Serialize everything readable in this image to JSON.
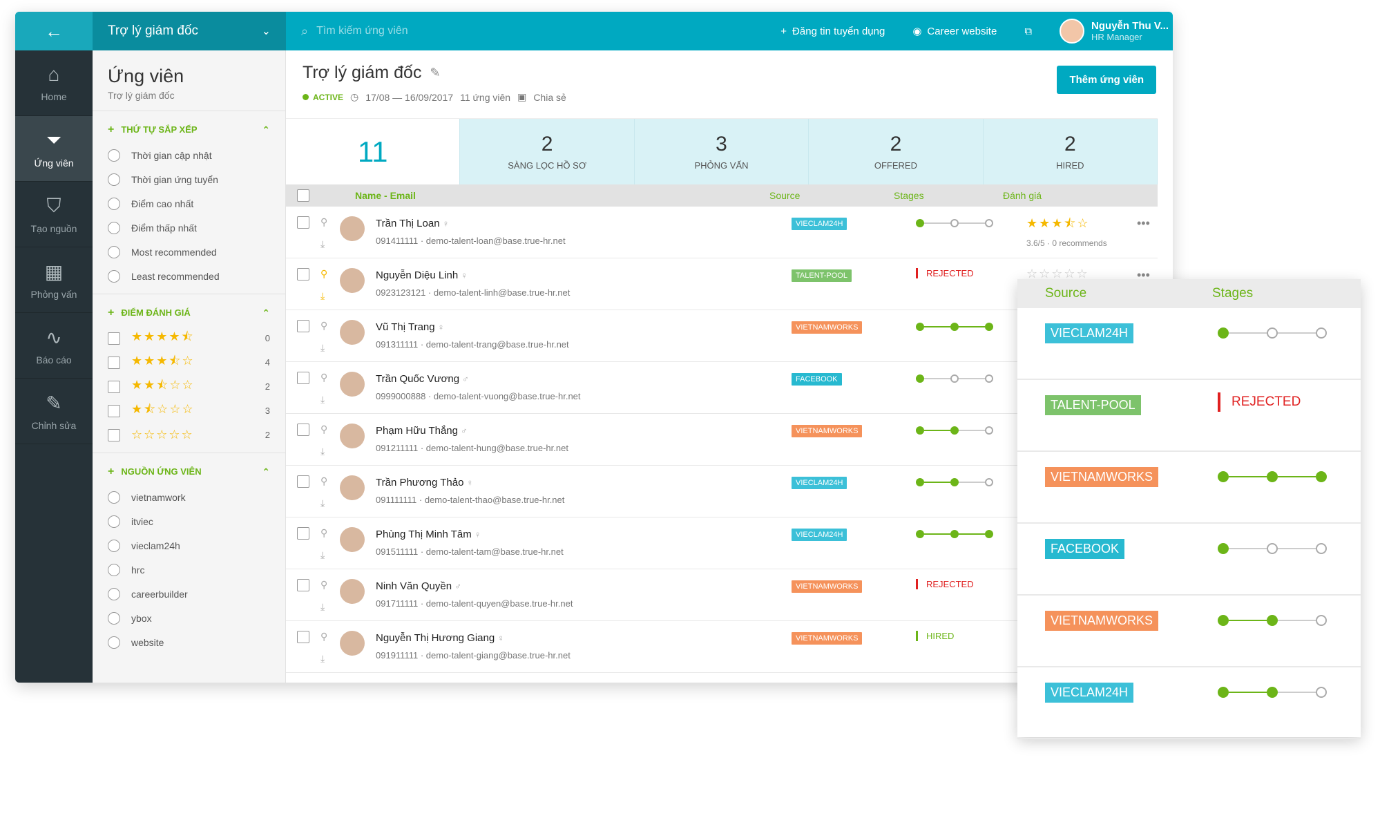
{
  "topbar": {
    "job_title": "Trợ lý giám đốc",
    "search_placeholder": "Tìm kiếm ứng viên",
    "post_job": "Đăng tin tuyển dụng",
    "career_website": "Career website",
    "user_name": "Nguyễn Thu V...",
    "user_role": "HR Manager"
  },
  "nav": [
    {
      "label": "Home",
      "icon": "home-icon"
    },
    {
      "label": "Ứng viên",
      "icon": "filter-icon"
    },
    {
      "label": "Tạo nguồn",
      "icon": "source-icon"
    },
    {
      "label": "Phỏng vấn",
      "icon": "calendar-icon"
    },
    {
      "label": "Báo cáo",
      "icon": "chart-icon"
    },
    {
      "label": "Chỉnh sửa",
      "icon": "edit-icon"
    }
  ],
  "filters": {
    "title": "Ứng viên",
    "subtitle": "Trợ lý giám đốc",
    "sort": {
      "title": "THỨ TỰ SẮP XẾP",
      "options": [
        "Thời gian cập nhật",
        "Thời gian ứng tuyển",
        "Điểm cao nhất",
        "Điểm thấp nhất",
        "Most recommended",
        "Least recommended"
      ]
    },
    "rating": {
      "title": "ĐIỂM ĐÁNH GIÁ",
      "items": [
        {
          "stars": "★★★★⯪",
          "count": "0"
        },
        {
          "stars": "★★★⯪☆",
          "count": "4"
        },
        {
          "stars": "★★⯪☆☆",
          "count": "2"
        },
        {
          "stars": "★⯪☆☆☆",
          "count": "3"
        },
        {
          "stars": "☆☆☆☆☆",
          "count": "2"
        }
      ]
    },
    "source": {
      "title": "NGUỒN ỨNG VIÊN",
      "options": [
        "vietnamwork",
        "itviec",
        "vieclam24h",
        "hrc",
        "careerbuilder",
        "ybox",
        "website"
      ]
    }
  },
  "main": {
    "title": "Trợ lý giám đốc",
    "status": "ACTIVE",
    "dates": "17/08 — 16/09/2017",
    "count_text": "11 ứng viên",
    "share": "Chia sẻ",
    "add_button": "Thêm ứng viên",
    "pipeline": [
      {
        "num": "11",
        "label": ""
      },
      {
        "num": "2",
        "label": "SÀNG LỌC HỒ SƠ"
      },
      {
        "num": "3",
        "label": "PHỎNG VẤN"
      },
      {
        "num": "2",
        "label": "OFFERED"
      },
      {
        "num": "2",
        "label": "HIRED"
      }
    ],
    "columns": {
      "name": "Name - Email",
      "source": "Source",
      "stages": "Stages",
      "rating": "Đánh giá"
    },
    "candidates": [
      {
        "name": "Trần Thị Loan",
        "gender": "♀",
        "phone": "091411111",
        "email": "demo-talent-loan@base.true-hr.net",
        "source": "VIECLAM24H",
        "src_class": "vieclam",
        "stage": 1,
        "status": "",
        "stars": "★★★⯪☆",
        "rating_text": "3.6/5 · 0 recommends",
        "pinned": false
      },
      {
        "name": "Nguyễn Diệu Linh",
        "gender": "♀",
        "phone": "0923123121",
        "email": "demo-talent-linh@base.true-hr.net",
        "source": "TALENT-POOL",
        "src_class": "talent",
        "stage": 0,
        "status": "REJECTED",
        "stars": "☆☆☆☆☆",
        "rating_text": "",
        "pinned": true
      },
      {
        "name": "Vũ Thị Trang",
        "gender": "♀",
        "phone": "091311111",
        "email": "demo-talent-trang@base.true-hr.net",
        "source": "VIETNAMWORKS",
        "src_class": "vnw",
        "stage": 3,
        "status": "",
        "stars": "",
        "rating_text": "",
        "pinned": false
      },
      {
        "name": "Trần Quốc Vương",
        "gender": "♂",
        "phone": "0999000888",
        "email": "demo-talent-vuong@base.true-hr.net",
        "source": "FACEBOOK",
        "src_class": "fb",
        "stage": 1,
        "status": "",
        "stars": "",
        "rating_text": "",
        "pinned": false
      },
      {
        "name": "Phạm Hữu Thắng",
        "gender": "♂",
        "phone": "091211111",
        "email": "demo-talent-hung@base.true-hr.net",
        "source": "VIETNAMWORKS",
        "src_class": "vnw",
        "stage": 2,
        "status": "",
        "stars": "",
        "rating_text": "",
        "pinned": false
      },
      {
        "name": "Trần Phương Thảo",
        "gender": "♀",
        "phone": "091111111",
        "email": "demo-talent-thao@base.true-hr.net",
        "source": "VIECLAM24H",
        "src_class": "vieclam",
        "stage": 2,
        "status": "",
        "stars": "",
        "rating_text": "",
        "pinned": false
      },
      {
        "name": "Phùng Thị Minh Tâm",
        "gender": "♀",
        "phone": "091511111",
        "email": "demo-talent-tam@base.true-hr.net",
        "source": "VIECLAM24H",
        "src_class": "vieclam",
        "stage": 3,
        "status": "",
        "stars": "",
        "rating_text": "",
        "pinned": false
      },
      {
        "name": "Ninh Văn Quyền",
        "gender": "♂",
        "phone": "091711111",
        "email": "demo-talent-quyen@base.true-hr.net",
        "source": "VIETNAMWORKS",
        "src_class": "vnw",
        "stage": 0,
        "status": "REJECTED",
        "stars": "",
        "rating_text": "",
        "pinned": false
      },
      {
        "name": "Nguyễn Thị Hương Giang",
        "gender": "♀",
        "phone": "091911111",
        "email": "demo-talent-giang@base.true-hr.net",
        "source": "VIETNAMWORKS",
        "src_class": "vnw",
        "stage": 0,
        "status": "HIRED",
        "stars": "",
        "rating_text": "",
        "pinned": false
      }
    ]
  },
  "popup": {
    "col_source": "Source",
    "col_stages": "Stages",
    "rows": [
      {
        "source": "VIECLAM24H",
        "src_class": "vieclam",
        "stage": 1,
        "status": ""
      },
      {
        "source": "TALENT-POOL",
        "src_class": "talent",
        "stage": 0,
        "status": "REJECTED"
      },
      {
        "source": "VIETNAMWORKS",
        "src_class": "vnw",
        "stage": 3,
        "status": ""
      },
      {
        "source": "FACEBOOK",
        "src_class": "fb",
        "stage": 1,
        "status": ""
      },
      {
        "source": "VIETNAMWORKS",
        "src_class": "vnw",
        "stage": 2,
        "status": ""
      },
      {
        "source": "VIECLAM24H",
        "src_class": "vieclam",
        "stage": 2,
        "status": ""
      }
    ]
  }
}
